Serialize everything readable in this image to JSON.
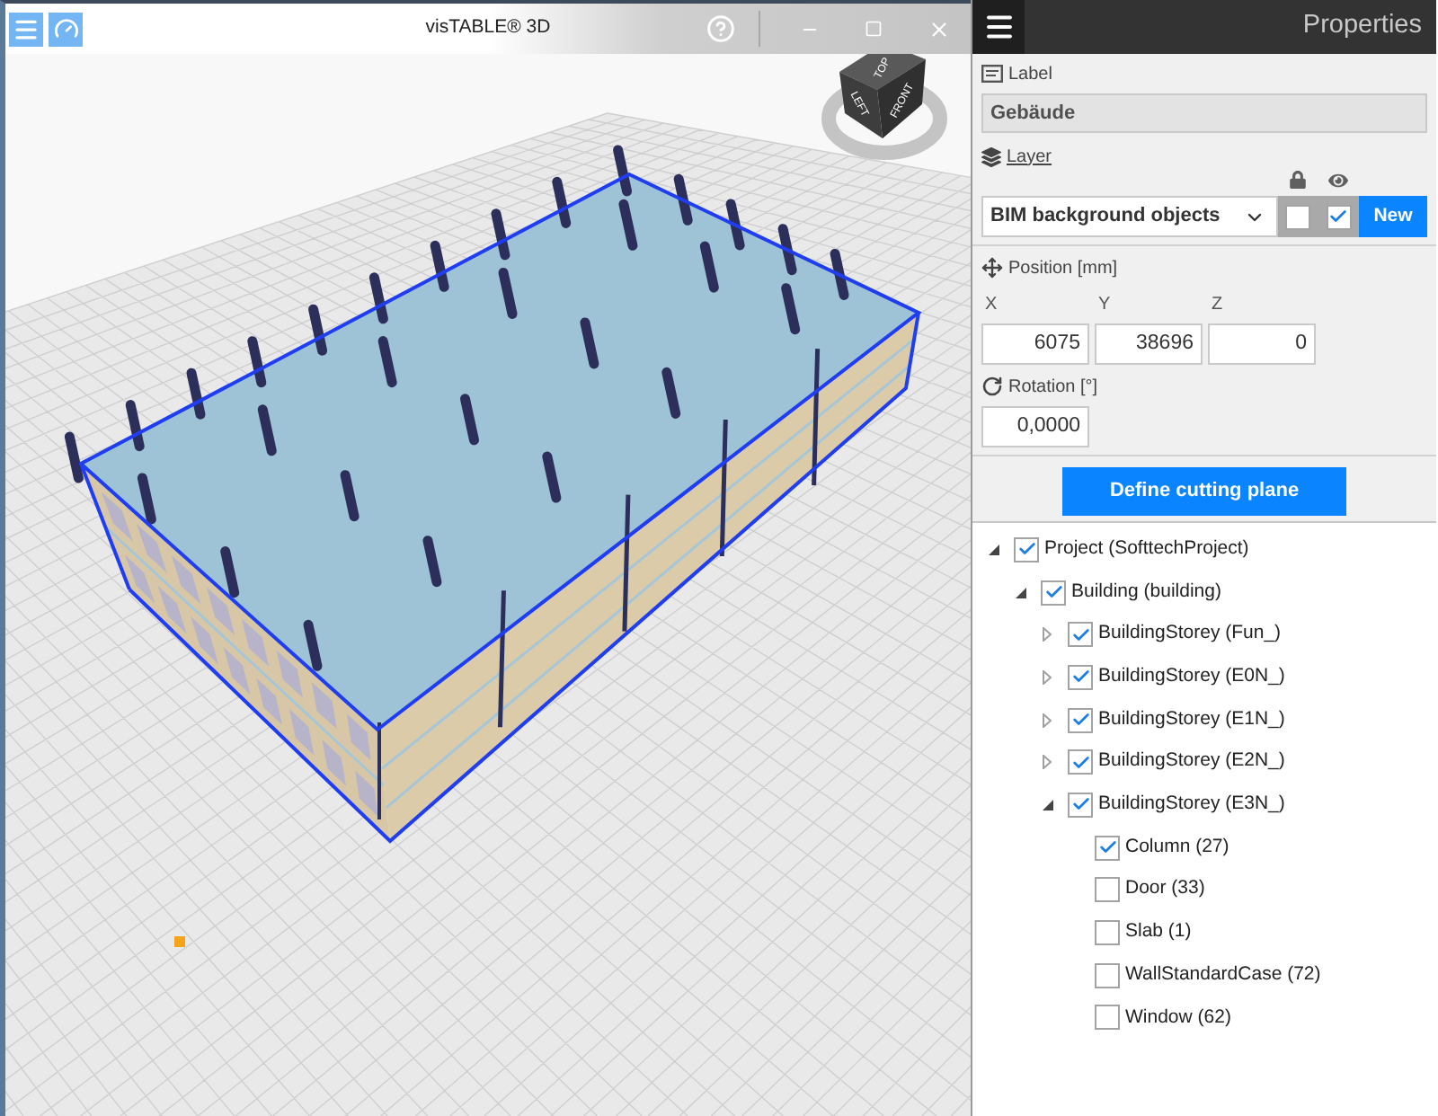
{
  "title_bar": {
    "title": "visTABLE® 3D"
  },
  "viewport": {
    "view_cube": {
      "faces": [
        {
          "kind": "top",
          "label": "TOP"
        },
        {
          "kind": "left",
          "label": "LEFT"
        },
        {
          "kind": "front",
          "label": "FRONT"
        }
      ]
    }
  },
  "properties": {
    "title": "Properties",
    "label": {
      "caption": "Label",
      "value": "Gebäude"
    },
    "layer": {
      "caption": "Layer",
      "value": "BIM background objects",
      "locked": false,
      "visible": true,
      "new_button": "New"
    },
    "position": {
      "caption": "Position [mm]",
      "fields": [
        {
          "axis": "X",
          "value": "6075"
        },
        {
          "axis": "Y",
          "value": "38696"
        },
        {
          "axis": "Z",
          "value": "0"
        }
      ]
    },
    "rotation": {
      "caption": "Rotation [°]",
      "value": "0,0000"
    },
    "cutting_plane_button": "Define cutting plane"
  },
  "tree": [
    {
      "label": "Project (SofttechProject)",
      "checked": true,
      "expanded": true,
      "children": [
        {
          "label": "Building (building)",
          "checked": true,
          "expanded": true,
          "children": [
            {
              "label": "BuildingStorey (Fun_)",
              "checked": true,
              "expanded": false
            },
            {
              "label": "BuildingStorey (E0N_)",
              "checked": true,
              "expanded": false
            },
            {
              "label": "BuildingStorey (E1N_)",
              "checked": true,
              "expanded": false
            },
            {
              "label": "BuildingStorey (E2N_)",
              "checked": true,
              "expanded": false
            },
            {
              "label": "BuildingStorey (E3N_)",
              "checked": true,
              "expanded": true,
              "children": [
                {
                  "label": "Column (27)",
                  "checked": true
                },
                {
                  "label": "Door (33)",
                  "checked": false
                },
                {
                  "label": "Slab (1)",
                  "checked": false
                },
                {
                  "label": "WallStandardCase (72)",
                  "checked": false
                },
                {
                  "label": "Window (62)",
                  "checked": false
                }
              ]
            }
          ]
        }
      ]
    }
  ]
}
